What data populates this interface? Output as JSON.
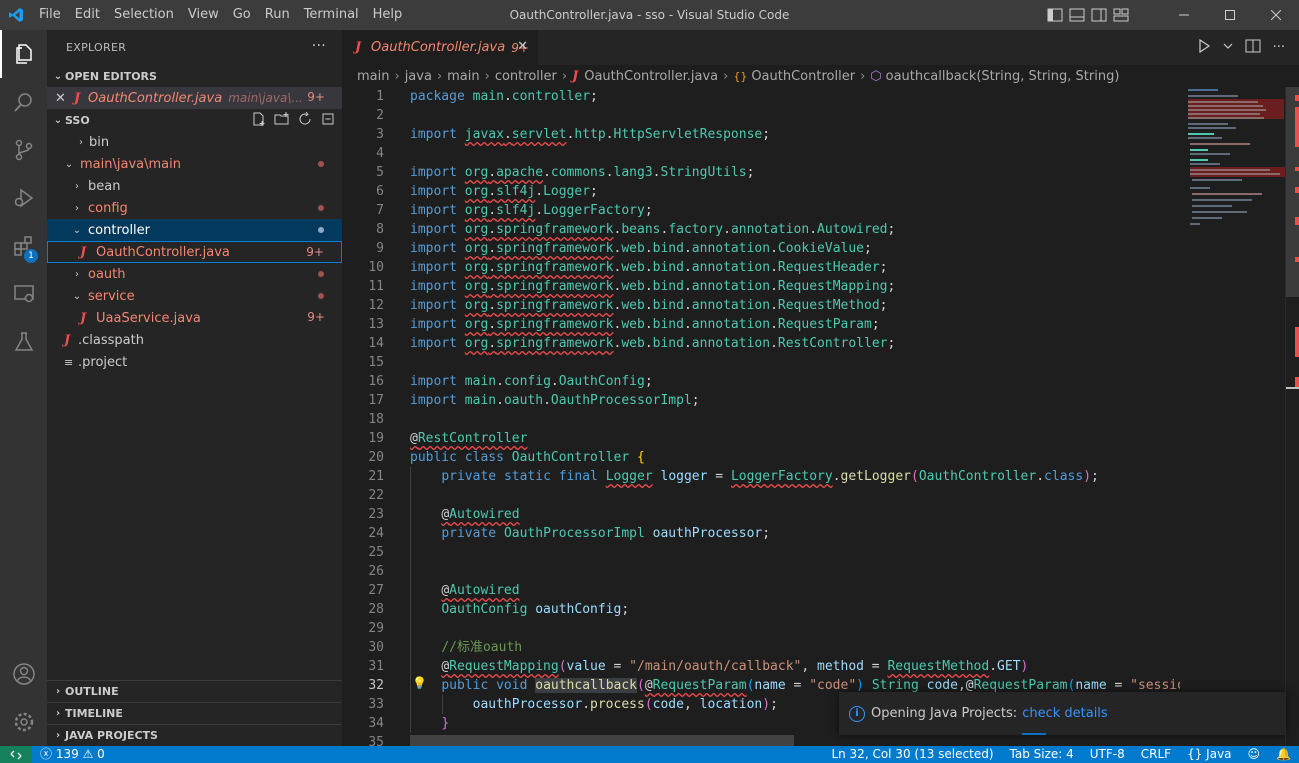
{
  "window": {
    "title": "OauthController.java - sso - Visual Studio Code",
    "menu": [
      "File",
      "Edit",
      "Selection",
      "View",
      "Go",
      "Run",
      "Terminal",
      "Help"
    ]
  },
  "activity": {
    "extensions_badge": "1"
  },
  "explorer": {
    "header": "EXPLORER",
    "open_editors_label": "OPEN EDITORS",
    "open_editor": {
      "name": "OauthController.java",
      "path": "main\\java\\...",
      "badge": "9+"
    },
    "folder_label": "SSO",
    "tree": [
      {
        "name": "bin",
        "type": "folder"
      },
      {
        "name": "main\\java\\main",
        "type": "folder-open"
      },
      {
        "name": "bean",
        "type": "folder"
      },
      {
        "name": "config",
        "type": "folder"
      },
      {
        "name": "controller",
        "type": "folder-open"
      },
      {
        "name": "OauthController.java",
        "type": "file",
        "badge": "9+"
      },
      {
        "name": "oauth",
        "type": "folder"
      },
      {
        "name": "service",
        "type": "folder-open"
      },
      {
        "name": "UaaService.java",
        "type": "file",
        "badge": "9+"
      },
      {
        "name": ".classpath",
        "type": "file"
      },
      {
        "name": ".project",
        "type": "file"
      }
    ],
    "bottom_sections": [
      "OUTLINE",
      "TIMELINE",
      "JAVA PROJECTS"
    ]
  },
  "editor": {
    "tab": {
      "label": "OauthController.java",
      "badge": "9+"
    },
    "breadcrumb": [
      "main",
      "java",
      "main",
      "controller",
      "OauthController.java",
      "OauthController",
      "oauthcallback(String, String, String)"
    ]
  },
  "notification": {
    "text": "Opening Java Projects:",
    "link": "check details"
  },
  "status": {
    "problems_errors": "139",
    "problems_warnings": "0",
    "cursor": "Ln 32, Col 30 (13 selected)",
    "tab_size": "Tab Size: 4",
    "encoding": "UTF-8",
    "eol": "CRLF",
    "language": "Java"
  },
  "colors": {
    "accent": "#007acc",
    "error": "#f14c4c",
    "sidebar": "#252526",
    "editor": "#1e1e1e"
  }
}
